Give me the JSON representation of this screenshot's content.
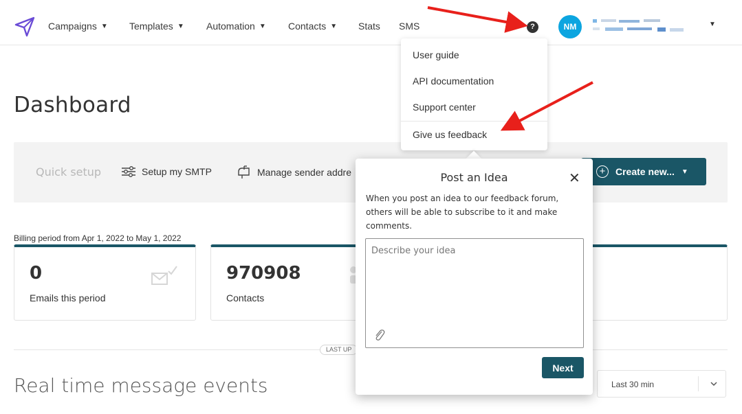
{
  "nav": {
    "items": [
      {
        "label": "Campaigns",
        "caret": "▼"
      },
      {
        "label": "Templates",
        "caret": "▼"
      },
      {
        "label": "Automation",
        "caret": "▼"
      },
      {
        "label": "Contacts",
        "caret": "▼"
      },
      {
        "label": "Stats",
        "caret": ""
      },
      {
        "label": "SMS",
        "caret": ""
      }
    ],
    "help_icon": "?",
    "avatar_initials": "NM",
    "user_caret": "▼"
  },
  "help_menu": {
    "items": [
      "User guide",
      "API documentation",
      "Support center",
      "Give us feedback"
    ]
  },
  "page": {
    "title": "Dashboard"
  },
  "quick_setup": {
    "label": "Quick setup",
    "items": [
      "Setup my SMTP",
      "Manage sender addre"
    ],
    "create_button": "Create new...",
    "create_caret": "▼"
  },
  "billing": {
    "period": "Billing period from Apr 1, 2022 to May 1, 2022"
  },
  "cards": [
    {
      "value": "0",
      "label": "Emails this period"
    },
    {
      "value": "970908",
      "label": "Contacts"
    }
  ],
  "last_updated": "LAST UP",
  "realtime": {
    "title": "Real time message events",
    "range": "Last 30 min"
  },
  "modal": {
    "title": "Post an Idea",
    "close": "✕",
    "description": "When you post an idea to our feedback forum, others will be able to subscribe to it and make comments.",
    "placeholder": "Describe your idea",
    "next_button": "Next"
  },
  "colors": {
    "accent": "#1a5666",
    "avatar": "#0ca5e0",
    "logo": "#6a4bd6",
    "annotation_arrow": "#e8201b"
  }
}
